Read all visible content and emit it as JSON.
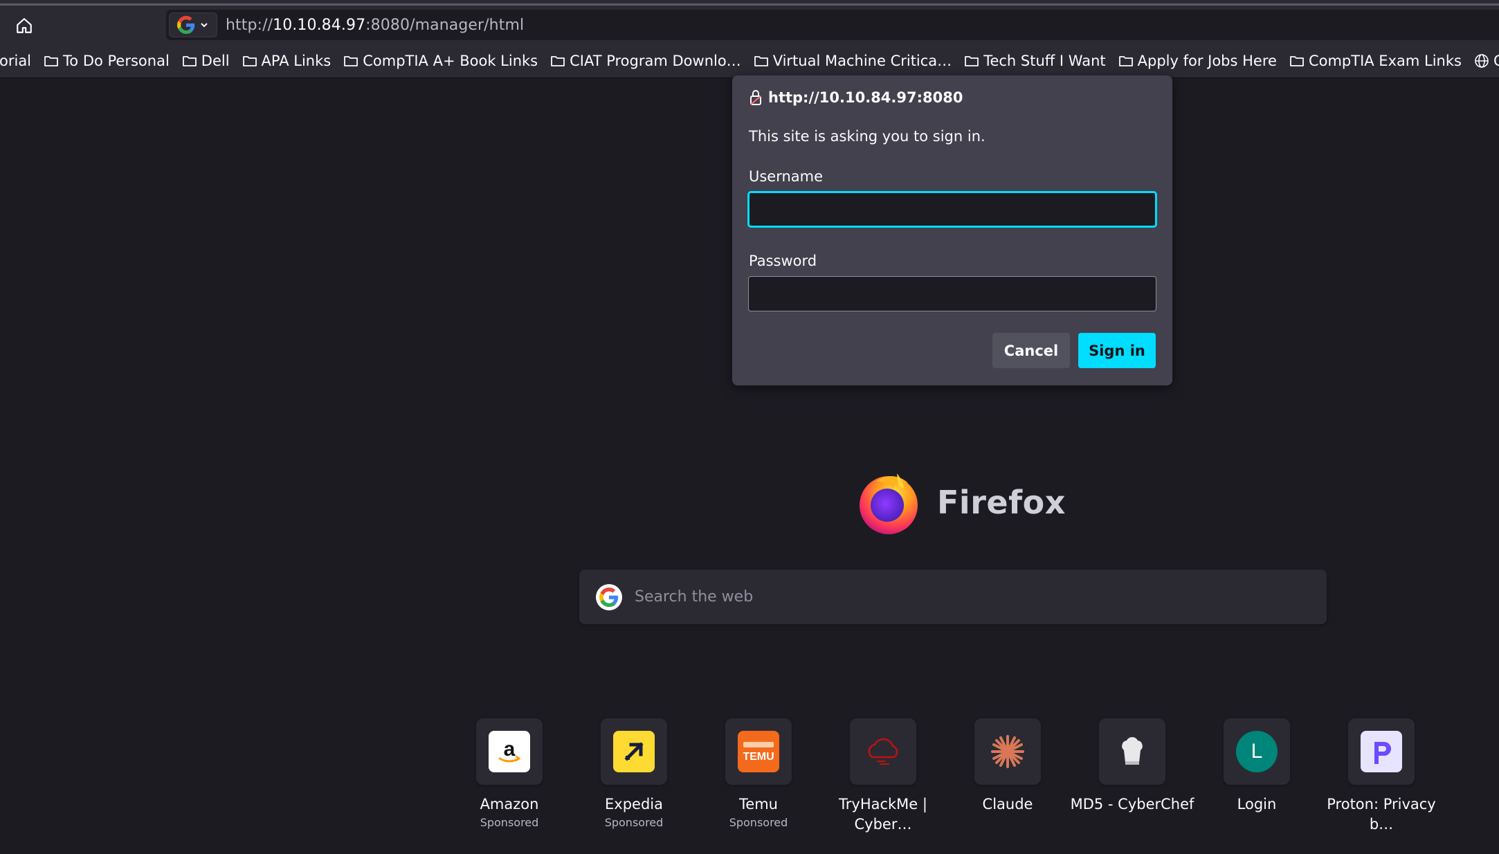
{
  "toolbar": {
    "url_prefix": "http://",
    "url_host": "10.10.84.97",
    "url_rest": ":8080/manager/html"
  },
  "bookmarks": [
    {
      "label": "orial",
      "icon": "folder-icon"
    },
    {
      "label": "To Do Personal",
      "icon": "folder-icon"
    },
    {
      "label": "Dell",
      "icon": "folder-icon"
    },
    {
      "label": "APA Links",
      "icon": "folder-icon"
    },
    {
      "label": "CompTIA A+ Book Links",
      "icon": "folder-icon"
    },
    {
      "label": "CIAT Program Downlo…",
      "icon": "folder-icon"
    },
    {
      "label": "Virtual Machine Critica…",
      "icon": "folder-icon"
    },
    {
      "label": "Tech Stuff I Want",
      "icon": "folder-icon"
    },
    {
      "label": "Apply for Jobs Here",
      "icon": "folder-icon"
    },
    {
      "label": "CompTIA Exam Links",
      "icon": "folder-icon"
    },
    {
      "label": "CSAC - S",
      "icon": "globe-icon"
    }
  ],
  "dialog": {
    "origin": "http://10.10.84.97:8080",
    "message": "This site is asking you to sign in.",
    "username_label": "Username",
    "username_value": "",
    "password_label": "Password",
    "password_value": "",
    "cancel_label": "Cancel",
    "signin_label": "Sign in"
  },
  "newtab": {
    "logo_word": "Firefox",
    "search_placeholder": "Search the web",
    "tiles": [
      {
        "title": "Amazon",
        "sub": "Sponsored",
        "icon": "amazon-icon"
      },
      {
        "title": "Expedia",
        "sub": "Sponsored",
        "icon": "expedia-icon"
      },
      {
        "title": "Temu",
        "sub": "Sponsored",
        "icon": "temu-icon"
      },
      {
        "title": "TryHackMe | Cyber…",
        "sub": "",
        "icon": "tryhackme-icon"
      },
      {
        "title": "Claude",
        "sub": "",
        "icon": "claude-icon"
      },
      {
        "title": "MD5 - CyberChef",
        "sub": "",
        "icon": "cyberchef-icon"
      },
      {
        "title": "Login",
        "sub": "",
        "icon": "login-icon",
        "letter": "L"
      },
      {
        "title": "Proton: Privacy b…",
        "sub": "",
        "icon": "proton-icon"
      }
    ]
  },
  "colors": {
    "accent": "#00ddff",
    "background": "#1c1b22",
    "toolbar": "#2b2a33",
    "dialog": "#42414d"
  }
}
